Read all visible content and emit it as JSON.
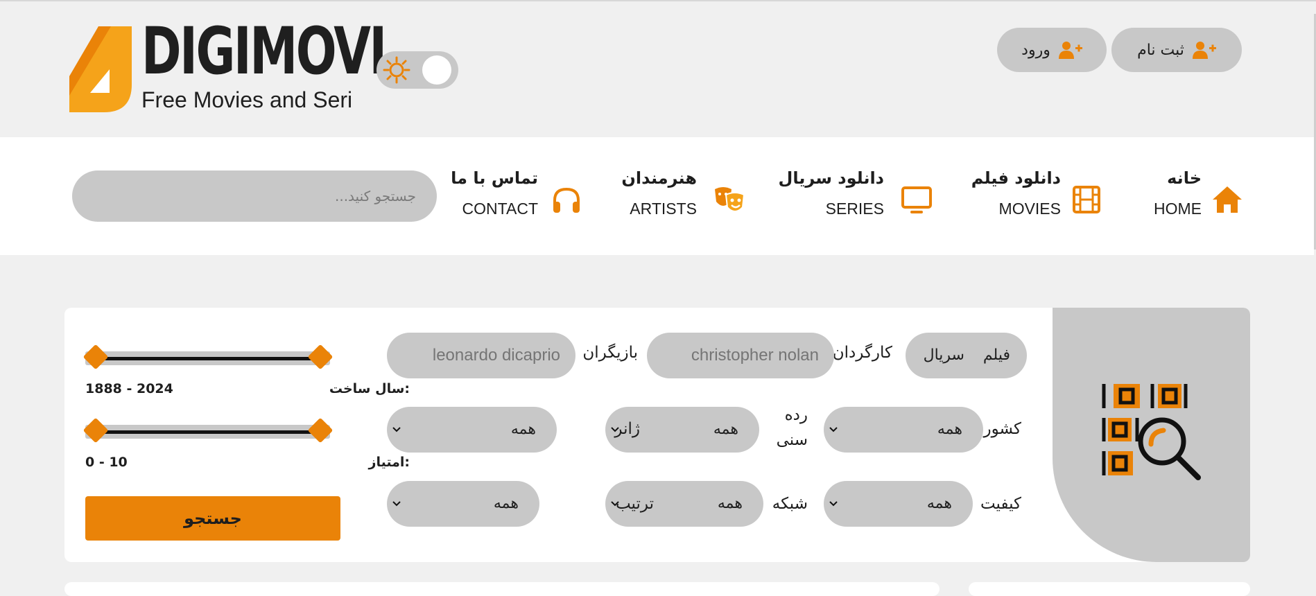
{
  "brand": {
    "name": "DIGIMOVI",
    "tagline": "Free Movies and Seri",
    "accent": "#EA8308"
  },
  "auth": {
    "register_label": "ثبت نام",
    "login_label": "ورود"
  },
  "nav": {
    "items": [
      {
        "fa": "خانه",
        "en": "HOME",
        "icon": "home-icon"
      },
      {
        "fa": "دانلود فیلم",
        "en": "MOVIES",
        "icon": "film-icon"
      },
      {
        "fa": "دانلود سریال",
        "en": "SERIES",
        "icon": "tv-icon"
      },
      {
        "fa": "هنرمندان",
        "en": "ARTISTS",
        "icon": "theater-masks-icon"
      },
      {
        "fa": "تماس با ما",
        "en": "CONTACT",
        "icon": "headphones-icon"
      }
    ],
    "search_placeholder": "جستجو کنید..."
  },
  "filters": {
    "type_options": [
      "فیلم",
      "سریال"
    ],
    "director_label": "کارگردان",
    "director_placeholder": "christopher nolan",
    "actors_label": "بازیگران",
    "actors_placeholder": "leonardo dicaprio",
    "country_label": "کشور",
    "country_value": "همه",
    "age_label_line1": "رده",
    "age_label_line2": "سنی",
    "age_value": "همه",
    "genre_label": "ژانر",
    "genre_value": "همه",
    "quality_label": "کیفیت",
    "quality_value": "همه",
    "network_label": "شبکه",
    "network_value": "همه",
    "sort_label": "ترتیب",
    "sort_value": "همه",
    "year_label": "سال ساخت:",
    "year_range": "1888 - 2024",
    "year_min": 1888,
    "year_max": 2024,
    "score_label": "امتیاز:",
    "score_range": "0 - 10",
    "score_min": 0,
    "score_max": 10,
    "search_button": "جستجو"
  }
}
